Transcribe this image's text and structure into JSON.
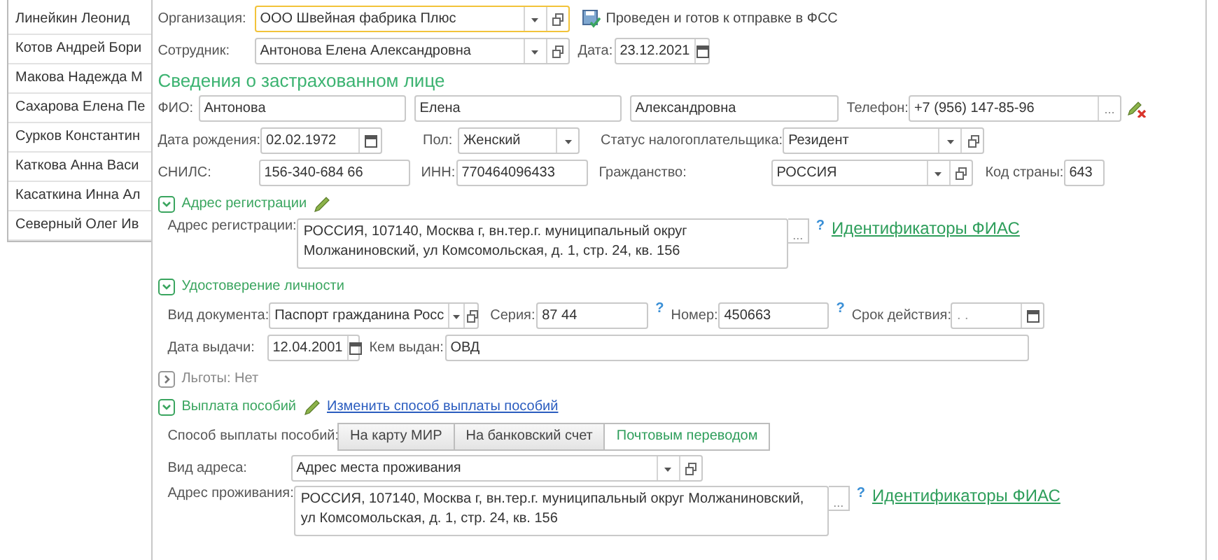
{
  "employee_list": [
    {
      "name": "Линейкин Леонид"
    },
    {
      "name": "Котов Андрей Бори"
    },
    {
      "name": "Макова Надежда М"
    },
    {
      "name": "Сахарова Елена Пе"
    },
    {
      "name": "Сурков Константин"
    },
    {
      "name": "Каткова Анна Васи"
    },
    {
      "name": "Касаткина Инна Ал"
    },
    {
      "name": "Северный Олег Ив"
    }
  ],
  "organization": {
    "label": "Организация:",
    "value": "ООО Швейная фабрика Плюс",
    "focused": true
  },
  "posted_status": "Проведен и готов к отправке в ФСС",
  "employee": {
    "label": "Сотрудник:",
    "value": "Антонова Елена Александровна"
  },
  "date": {
    "label": "Дата:",
    "value": "23.12.2021"
  },
  "section_title": "Сведения о застрахованном лице",
  "fio": {
    "label": "ФИО:",
    "last_name": "Антонова",
    "first_name": "Елена",
    "middle_name": "Александровна"
  },
  "phone": {
    "label": "Телефон:",
    "value": "+7 (956) 147-85-96",
    "more_button": "..."
  },
  "birth_date": {
    "label": "Дата рождения:",
    "value": "02.02.1972"
  },
  "gender": {
    "label": "Пол:",
    "value": "Женский"
  },
  "tax_status": {
    "label": "Статус налогоплательщика:",
    "value": "Резидент"
  },
  "snils": {
    "label": "СНИЛС:",
    "value": "156-340-684 66"
  },
  "inn": {
    "label": "ИНН:",
    "value": "770464096433"
  },
  "citizenship": {
    "label": "Гражданство:",
    "value": "РОССИЯ"
  },
  "country_code": {
    "label": "Код страны:",
    "value": "643"
  },
  "registration": {
    "title": "Адрес регистрации",
    "expanded": true,
    "label": "Адрес регистрации:",
    "value": "РОССИЯ, 107140, Москва г, вн.тер.г. муниципальный округ Молжаниновский, ул Комсомольская, д. 1, стр. 24, кв. 156",
    "more_button": "...",
    "help": "?",
    "link": "Идентификаторы ФИАС"
  },
  "identity": {
    "title": "Удостоверение личности",
    "expanded": true,
    "doc_type": {
      "label": "Вид документа:",
      "value": "Паспорт гражданина Росс"
    },
    "series": {
      "label": "Серия:",
      "value": "87 44",
      "help": "?"
    },
    "number": {
      "label": "Номер:",
      "value": "450663",
      "help": "?"
    },
    "validity": {
      "label": "Срок действия:",
      "placeholder": ".  ."
    },
    "issue_date": {
      "label": "Дата выдачи:",
      "value": "12.04.2001"
    },
    "issued_by": {
      "label": "Кем выдан:",
      "value": "ОВД"
    }
  },
  "benefits": {
    "title": "Льготы: Нет",
    "expanded": false
  },
  "payment": {
    "title": "Выплата пособий",
    "expanded": true,
    "link": "Изменить способ выплаты пособий",
    "method_label": "Способ выплаты пособий:",
    "methods": [
      {
        "label": "На карту МИР",
        "selected": false
      },
      {
        "label": "На банковский счет",
        "selected": false
      },
      {
        "label": "Почтовым переводом",
        "selected": true
      }
    ],
    "address_kind": {
      "label": "Вид адреса:",
      "value": "Адрес места проживания"
    },
    "residence": {
      "label": "Адрес проживания:",
      "value": "РОССИЯ, 107140, Москва г, вн.тер.г. муниципальный округ Молжаниновский, ул Комсомольская, д. 1, стр. 24, кв. 156",
      "more_button": "...",
      "help": "?",
      "link": "Идентификаторы ФИАС"
    }
  }
}
